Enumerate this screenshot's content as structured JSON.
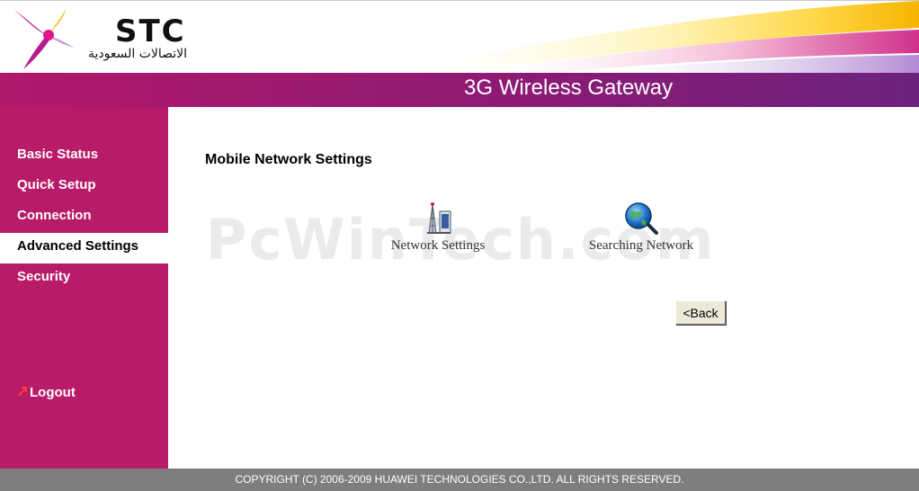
{
  "header": {
    "brand": "STC",
    "brand_arabic": "الاتصالات السعودية",
    "title": "3G Wireless Gateway"
  },
  "sidebar": {
    "items": [
      {
        "label": "Basic Status"
      },
      {
        "label": "Quick Setup"
      },
      {
        "label": "Connection"
      },
      {
        "label": "Advanced Settings",
        "active": true
      },
      {
        "label": "Security"
      }
    ],
    "logout_label": "Logout"
  },
  "main": {
    "page_title": "Mobile Network Settings",
    "tiles": [
      {
        "label": "Network Settings",
        "icon": "network-settings-icon"
      },
      {
        "label": "Searching Network",
        "icon": "searching-network-icon"
      }
    ],
    "back_label": "<Back"
  },
  "watermark": "PcWinTech.com",
  "footer": {
    "copyright": "COPYRIGHT (C) 2006-2009 HUAWEI TECHNOLOGIES CO.,LTD. ALL RIGHTS RESERVED."
  },
  "colors": {
    "sidebar": "#b81b68",
    "band_start": "#b1196b",
    "band_end": "#6c237e",
    "footer": "#7e7e7e"
  }
}
